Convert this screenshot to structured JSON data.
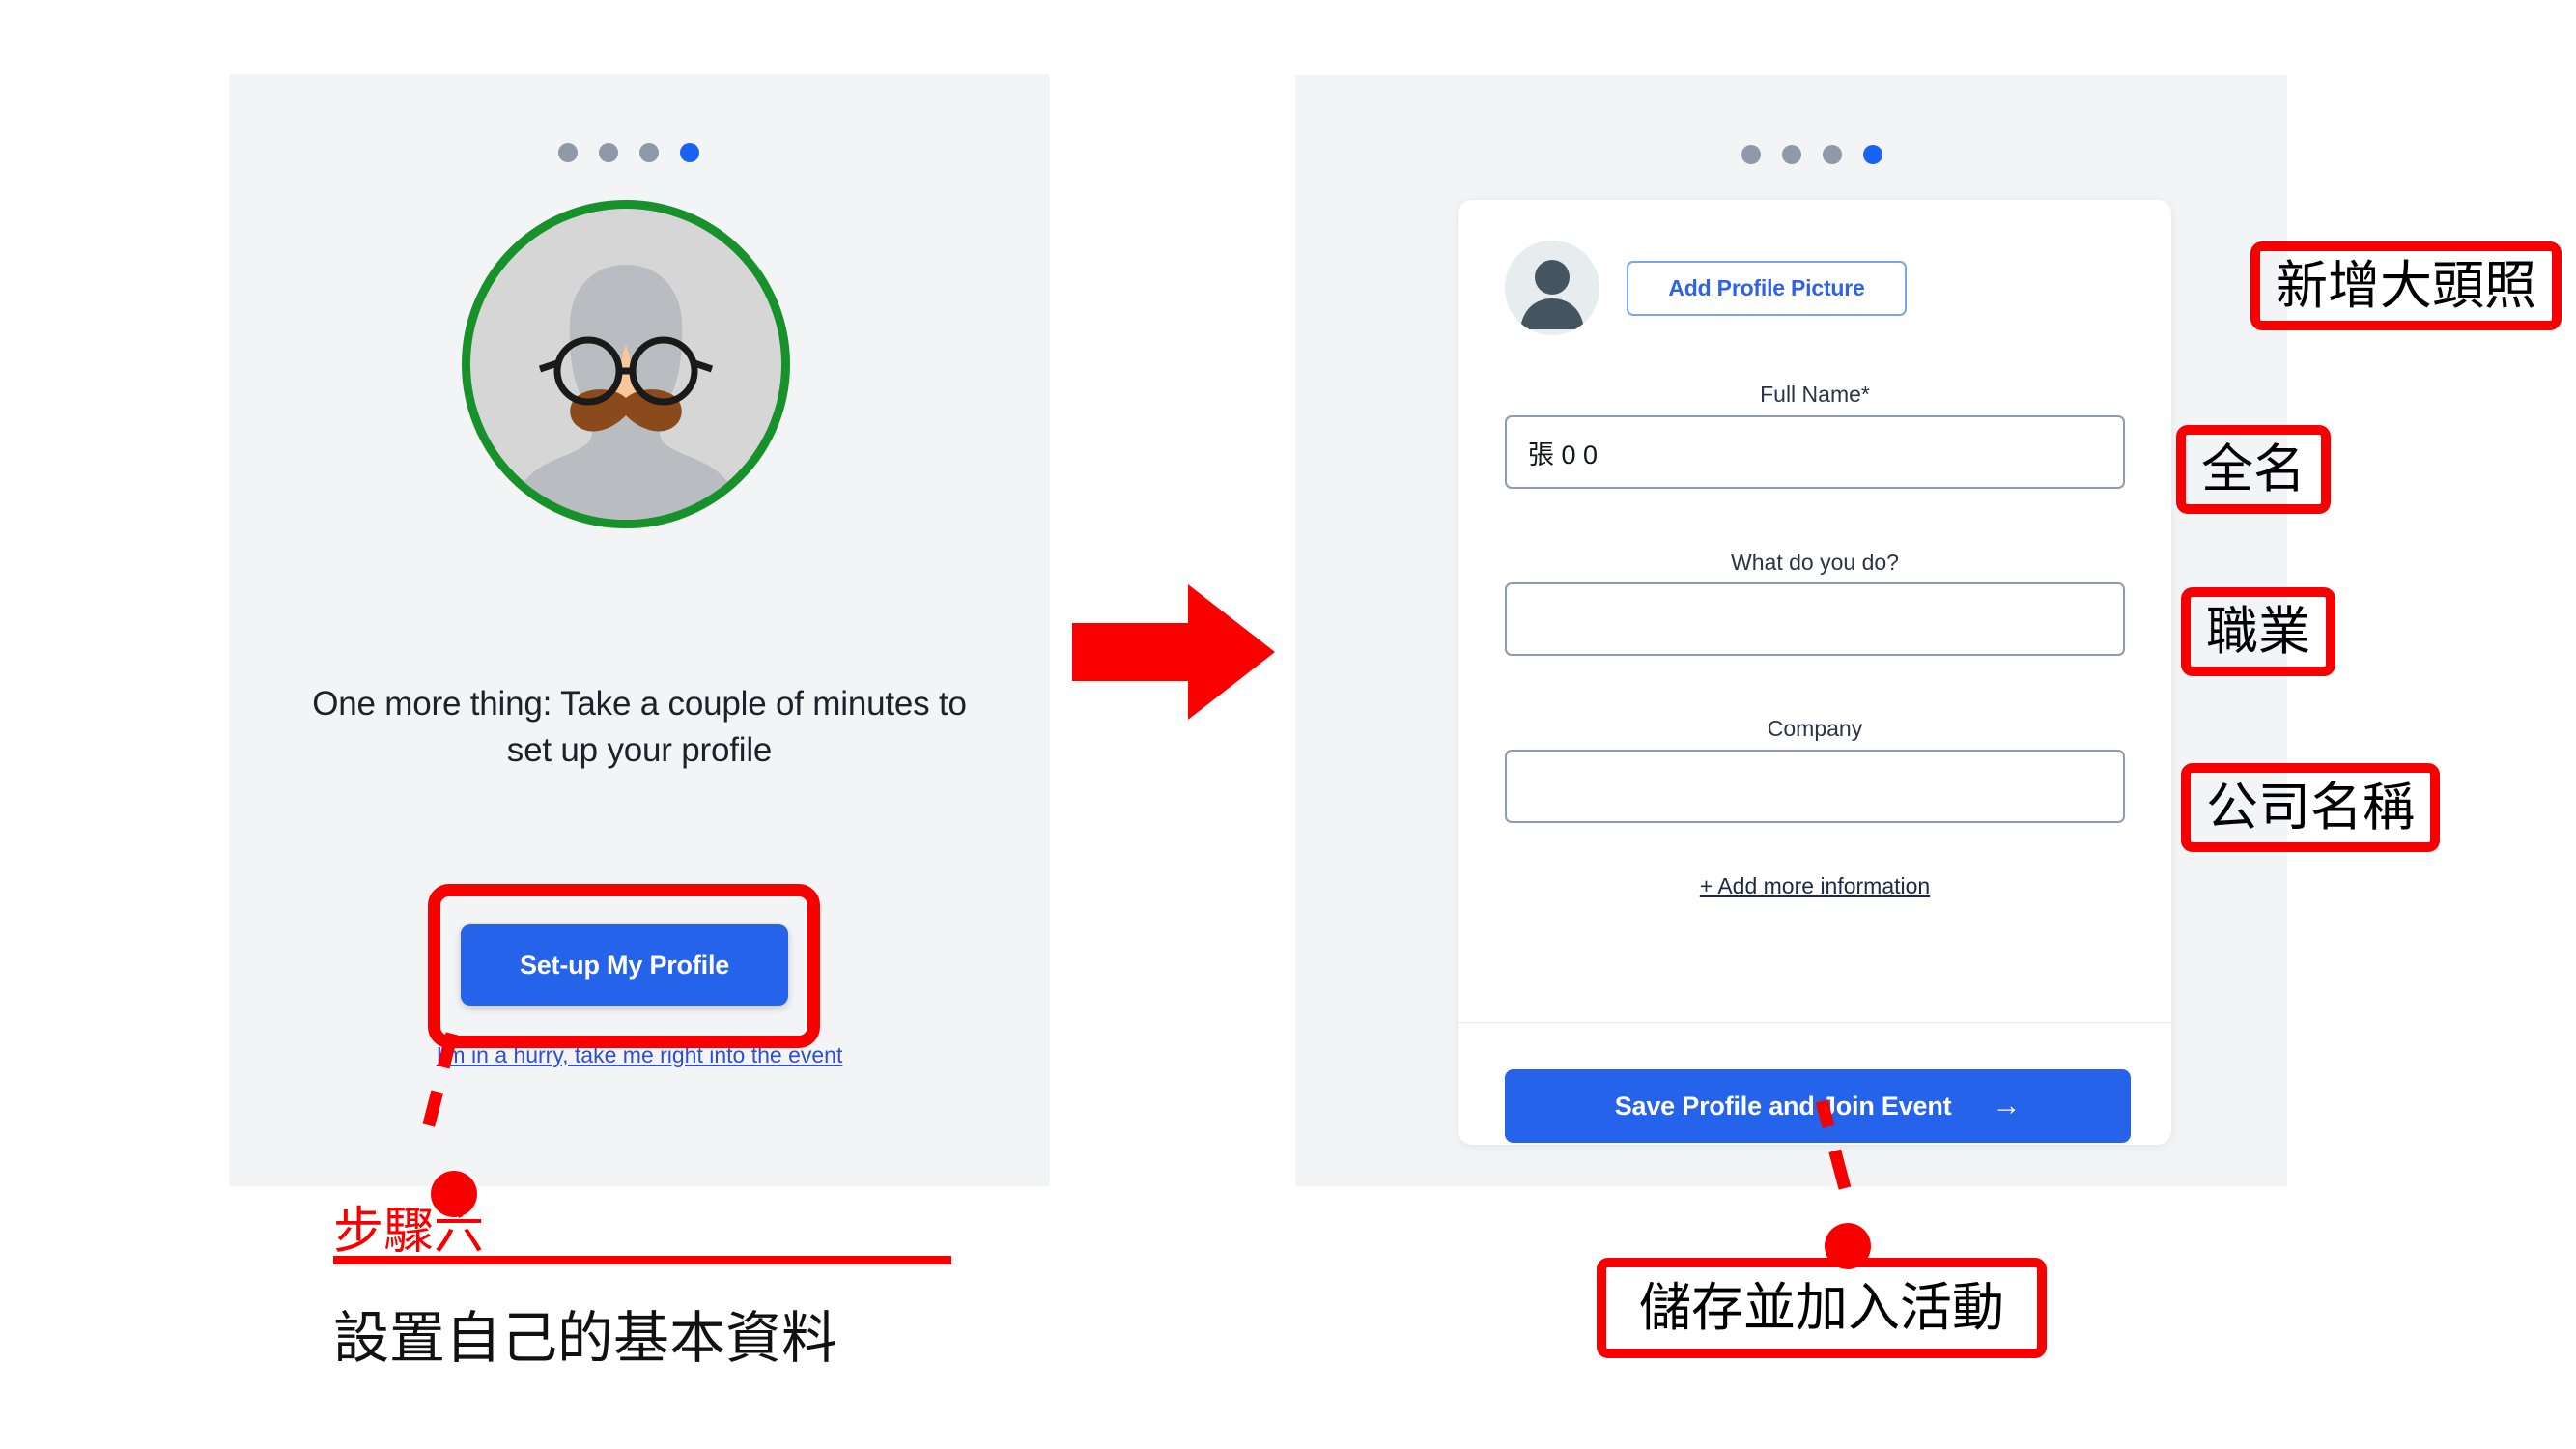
{
  "left_screen": {
    "step_dots": [
      {
        "state": "inactive"
      },
      {
        "state": "inactive"
      },
      {
        "state": "inactive"
      },
      {
        "state": "active"
      }
    ],
    "avatar_icon": "avatar-with-glasses-and-moustache",
    "headline": "One more thing: Take a couple of minutes to set up your profile",
    "setup_button_label": "Set-up My Profile",
    "skip_link_label": "I'm in a hurry, take me right into the event"
  },
  "right_screen": {
    "step_dots": [
      {
        "state": "inactive"
      },
      {
        "state": "inactive"
      },
      {
        "state": "inactive"
      },
      {
        "state": "active"
      }
    ],
    "profile_thumb_icon": "default-person-avatar",
    "add_picture_label": "Add Profile Picture",
    "fields": [
      {
        "label": "Full Name*",
        "value": "張 0 0",
        "placeholder": ""
      },
      {
        "label": "What do you do?",
        "value": "",
        "placeholder": ""
      },
      {
        "label": "Company",
        "value": "",
        "placeholder": ""
      }
    ],
    "add_more_label": "+ Add more information",
    "save_button_label": "Save Profile and Join Event",
    "save_button_arrow": "→"
  },
  "annotations": {
    "flow_arrow_icon": "red-right-arrow",
    "callouts": [
      {
        "text": "新增大頭照"
      },
      {
        "text": "全名"
      },
      {
        "text": "職業"
      },
      {
        "text": "公司名稱"
      },
      {
        "text": "儲存並加入活動"
      }
    ],
    "step_label": "步驟六",
    "step_description": "設置自己的基本資料",
    "accent_color": "#f80000",
    "primary_color": "#2563eb",
    "ring_color": "#17912a"
  }
}
